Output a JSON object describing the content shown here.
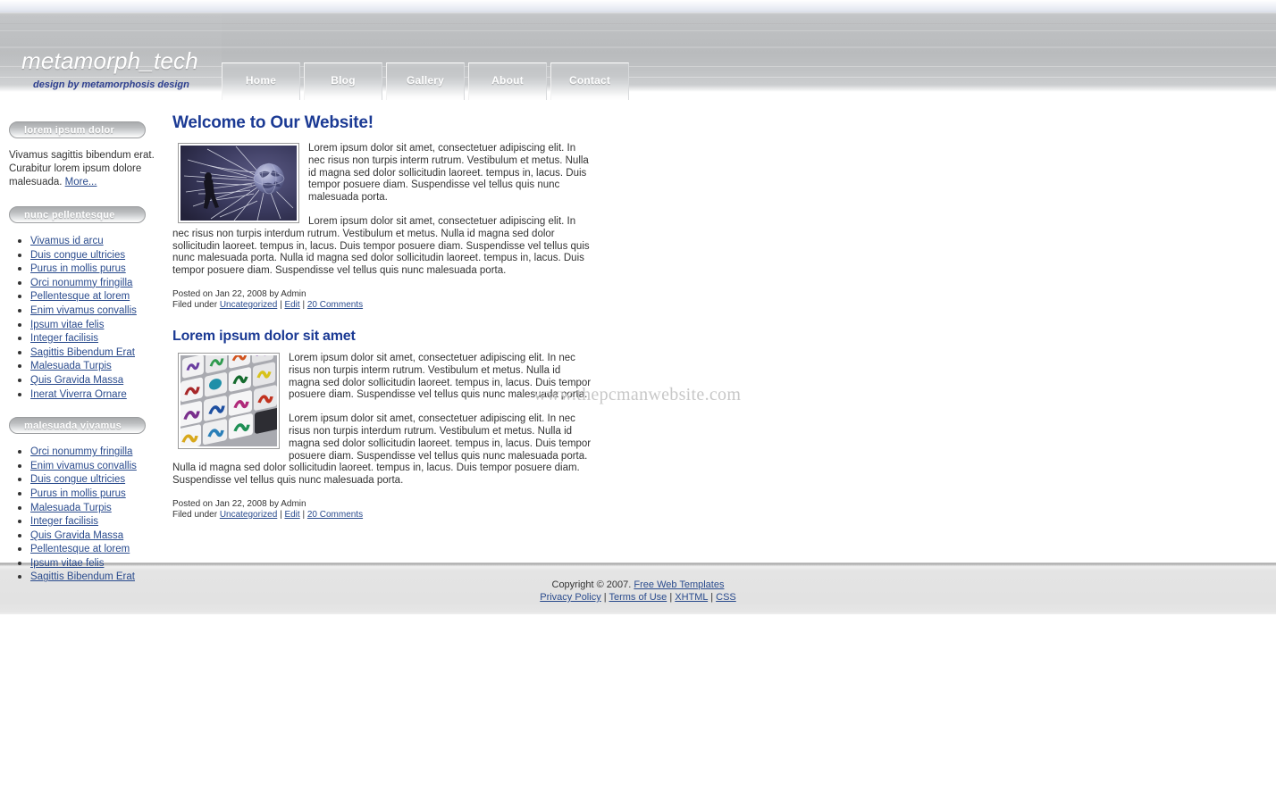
{
  "header": {
    "site_title": "metamorph_tech",
    "tagline": "design by metamorphosis design",
    "nav": [
      {
        "label": "Home"
      },
      {
        "label": "Blog"
      },
      {
        "label": "Gallery"
      },
      {
        "label": "About"
      },
      {
        "label": "Contact"
      }
    ]
  },
  "sidebar": {
    "panels": [
      {
        "heading": "lorem ipsum dolor",
        "text": "Vivamus sagittis bibendum erat. Curabitur lorem ipsum dolore malesuada. ",
        "more_label": "More..."
      },
      {
        "heading": "nunc pellentesque",
        "items": [
          "Vivamus id arcu",
          "Duis congue ultricies",
          "Purus in mollis purus",
          "Orci nonummy fringilla",
          "Pellentesque at lorem",
          "Enim vivamus convallis",
          "Ipsum vitae felis",
          "Integer facilisis",
          "Sagittis Bibendum Erat",
          "Malesuada Turpis",
          "Quis Gravida Massa",
          "Inerat Viverra Ornare"
        ]
      },
      {
        "heading": "malesuada vivamus",
        "items": [
          "Orci nonummy fringilla",
          "Enim vivamus convallis",
          "Duis congue ultricies",
          "Purus in mollis purus",
          "Malesuada Turpis",
          "Integer facilisis",
          "Quis Gravida Massa",
          "Pellentesque at lorem",
          "Ipsum vitae felis",
          "Sagittis Bibendum Erat"
        ]
      }
    ]
  },
  "main": {
    "watermark": "www.thepcmanwebsite.com",
    "posts": [
      {
        "title": "Welcome to Our Website!",
        "image_alt": "spider-web-globe-silhouette-image",
        "paragraph1": "Lorem ipsum dolor sit amet, consectetuer adipiscing elit. In nec risus non turpis interm rutrum. Vestibulum et metus. Nulla id magna sed dolor sollicitudin laoreet. tempus in, lacus. Duis tempor posuere diam. Suspendisse vel tellus quis nunc malesuada porta.",
        "paragraph2": "Lorem ipsum dolor sit amet, consectetuer adipiscing elit. In nec risus non turpis interdum rutrum. Vestibulum et metus. Nulla id magna sed dolor sollicitudin laoreet. tempus in, lacus. Duis tempor posuere diam. Suspendisse vel tellus quis nunc malesuada porta. Nulla id magna sed dolor sollicitudin laoreet. tempus in, lacus. Duis tempor posuere diam. Suspendisse vel tellus quis nunc malesuada porta.",
        "posted_on": "Posted on Jan 22, 2008 by Admin",
        "filed_under_label": "Filed under ",
        "category": "Uncategorized",
        "sep1": " | ",
        "edit": "Edit",
        "sep2": " | ",
        "comments": "20 Comments"
      },
      {
        "title": "Lorem ipsum dolor sit amet",
        "image_alt": "colorful-keyboard-keys-image",
        "paragraph1": "Lorem ipsum dolor sit amet, consectetuer adipiscing elit. In nec risus non turpis interm rutrum. Vestibulum et metus. Nulla id magna sed dolor sollicitudin laoreet. tempus in, lacus. Duis tempor posuere diam. Suspendisse vel tellus quis nunc malesuada porta.",
        "paragraph2": "Lorem ipsum dolor sit amet, consectetuer adipiscing elit. In nec risus non turpis interdum rutrum. Vestibulum et metus. Nulla id magna sed dolor sollicitudin laoreet. tempus in, lacus. Duis tempor posuere diam. Suspendisse vel tellus quis nunc malesuada porta. Nulla id magna sed dolor sollicitudin laoreet. tempus in, lacus. Duis tempor posuere diam. Suspendisse vel tellus quis nunc malesuada porta.",
        "posted_on": "Posted on Jan 22, 2008 by Admin",
        "filed_under_label": "Filed under ",
        "category": "Uncategorized",
        "sep1": " | ",
        "edit": "Edit",
        "sep2": " | ",
        "comments": "20 Comments"
      }
    ]
  },
  "footer": {
    "copyright_text": "Copyright © 2007. ",
    "copyright_link": "Free Web Templates",
    "links": [
      {
        "label": "Privacy Policy"
      },
      {
        "label": "Terms of Use"
      },
      {
        "label": "XHTML"
      },
      {
        "label": "CSS"
      }
    ],
    "separator": " | "
  },
  "colors": {
    "heading_blue": "#1b3a94",
    "link_blue": "#2a4b8d",
    "tagline_blue": "#2d3f8f",
    "header_gray": "#bcbec0",
    "footer_gray": "#e2e2e2",
    "watermark_gray": "#c8c8c8"
  }
}
